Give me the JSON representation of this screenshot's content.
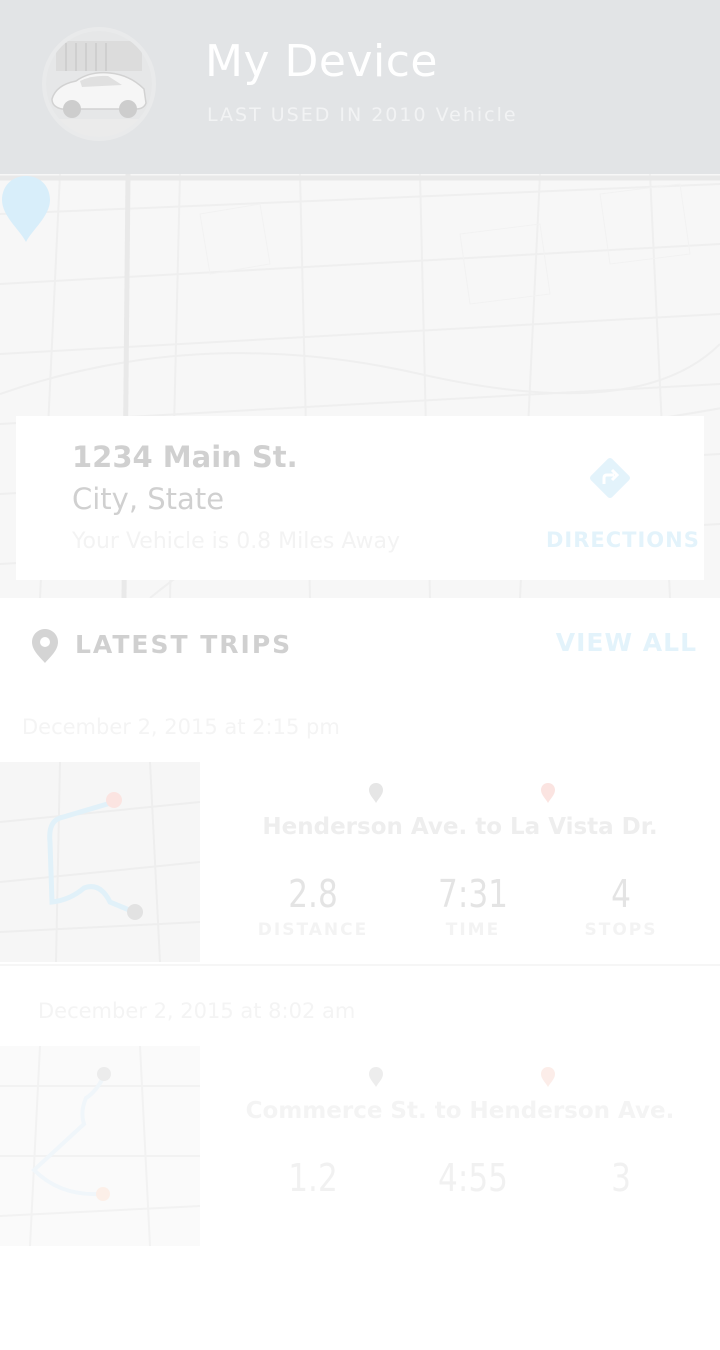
{
  "header": {
    "title": "My Device",
    "subtitle": "LAST USED IN 2010 Vehicle"
  },
  "location": {
    "street": "1234 Main St.",
    "city": "City, State",
    "distance_text": "Your Vehicle is 0.8 Miles Away",
    "directions_label": "DIRECTIONS"
  },
  "trips": {
    "title": "LATEST TRIPS",
    "view_all_label": "VIEW ALL",
    "items": [
      {
        "date": "December 2, 2015 at 2:15 pm",
        "route": "Henderson Ave. to La Vista Dr.",
        "distance": "2.8",
        "distance_label": "DISTANCE",
        "time": "7:31",
        "time_label": "TIME",
        "stops": "4",
        "stops_label": "STOPS"
      },
      {
        "date": "December 2, 2015 at 8:02 am",
        "route": "Commerce St. to Henderson Ave.",
        "distance": "1.2",
        "time": "4:55",
        "stops": "3"
      }
    ]
  },
  "colors": {
    "accent": "#e3f3fb",
    "pin_blue": "#d8eefa",
    "pin_red": "#fbe4e1",
    "header_bg": "#e2e4e6"
  }
}
